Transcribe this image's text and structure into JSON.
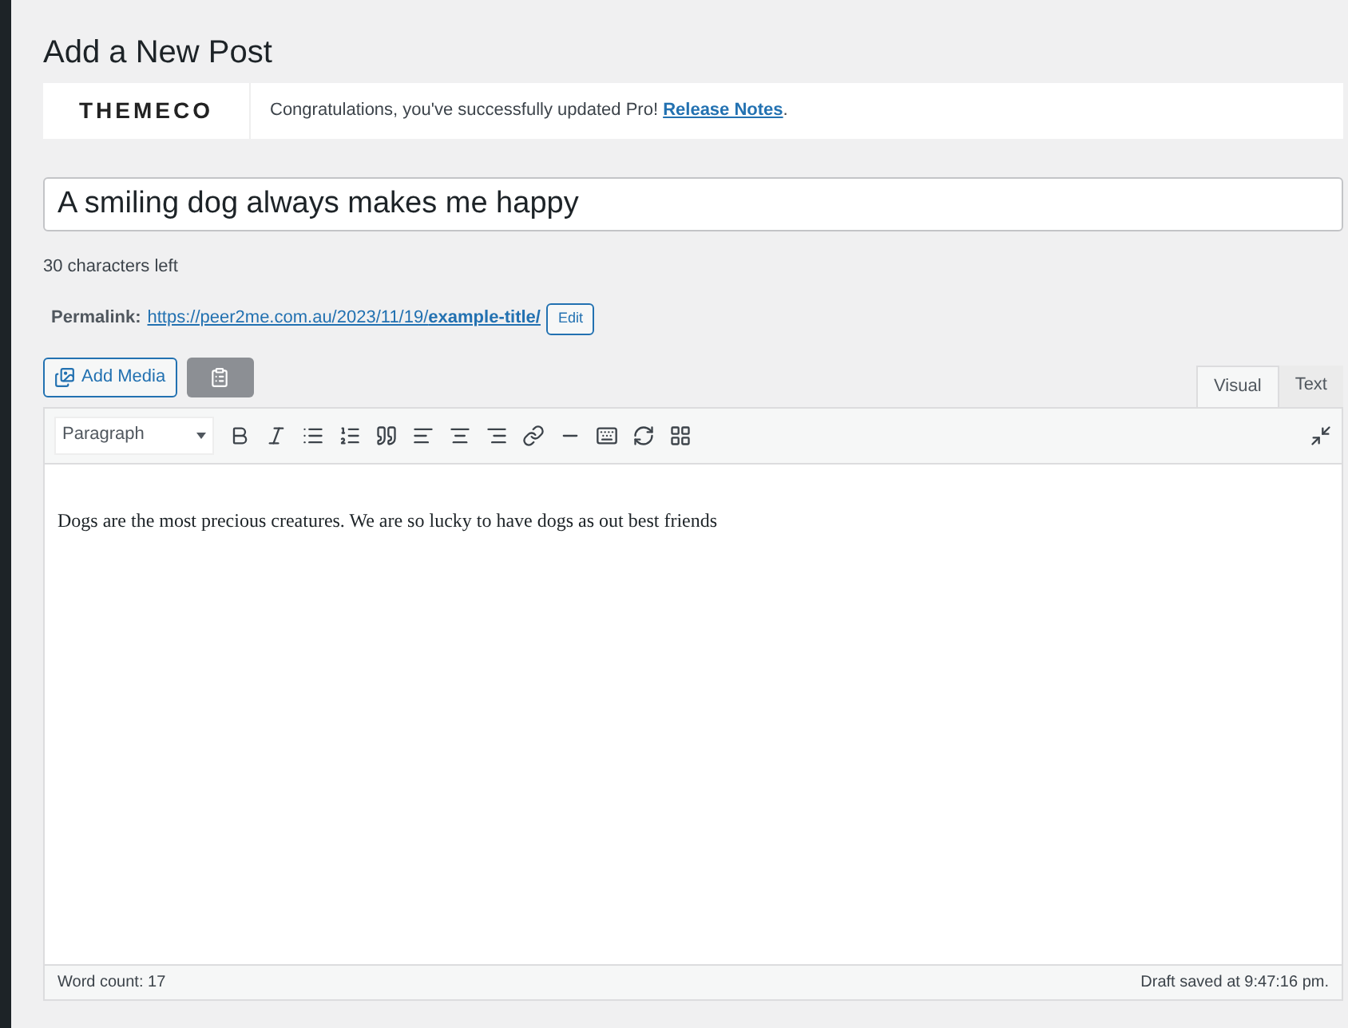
{
  "page_title": "Add a New Post",
  "notice": {
    "logo": "THEMECO",
    "message": "Congratulations, you've successfully updated Pro! ",
    "link": "Release Notes",
    "suffix": "."
  },
  "post_title": {
    "value": "A smiling dog always makes me happy"
  },
  "chars_left": "30 characters left",
  "permalink": {
    "label": "Permalink:",
    "url": "https://peer2me.com.au/2023/11/19/**example-title/**",
    "edit_button": "Edit"
  },
  "add_media_button": "Add Media",
  "editor_tabs": [
    {
      "label": "Visual",
      "selected": true
    },
    {
      "label": "Text",
      "selected": false
    }
  ],
  "format_dropdown": {
    "value": "Paragraph"
  },
  "content": "Dogs are the most precious creatures. We are so lucky to have dogs as out best friends",
  "status_bar": {
    "word_count": "Word count: 17",
    "draft_saved": "Draft saved at 9:47:16 pm."
  }
}
